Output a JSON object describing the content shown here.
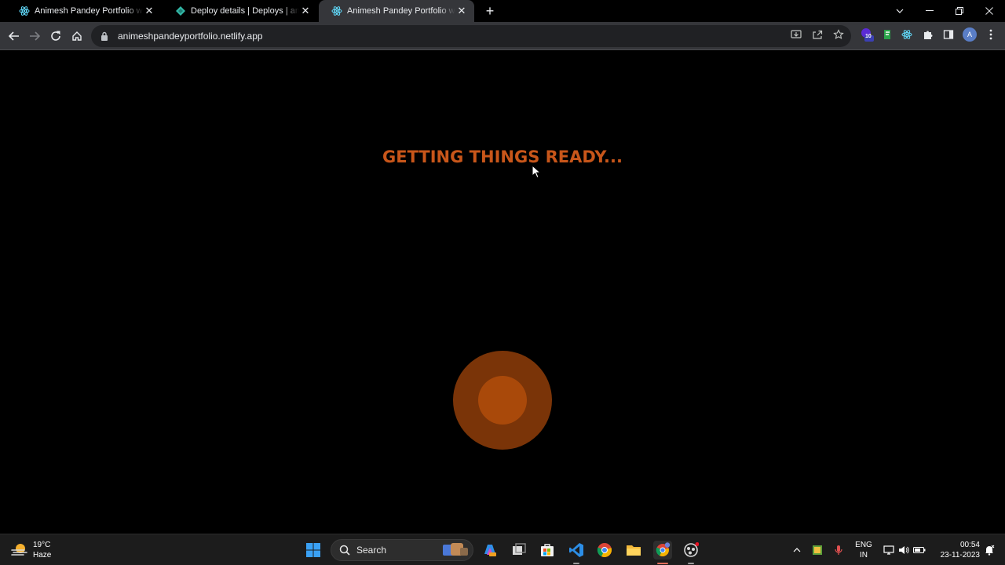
{
  "browser": {
    "tabs": [
      {
        "title": "Animesh Pandey Portfolio website",
        "favicon": "react-icon",
        "active": false
      },
      {
        "title": "Deploy details | Deploys | animesh",
        "favicon": "netlify-icon",
        "active": false
      },
      {
        "title": "Animesh Pandey Portfolio website",
        "favicon": "react-icon",
        "active": true
      }
    ],
    "url": "animeshpandeyportfolio.netlify.app",
    "extension_badge": "10",
    "profile_initial": "A"
  },
  "page": {
    "loading_text": "GETTING THINGS READY...",
    "accent_color": "#c8561a",
    "loader_outer_color": "#7a3408",
    "loader_inner_color": "#a9490a"
  },
  "taskbar": {
    "weather": {
      "temp": "19°C",
      "condition": "Haze"
    },
    "search_label": "Search",
    "language": {
      "line1": "ENG",
      "line2": "IN"
    },
    "clock": {
      "time": "00:54",
      "date": "23-11-2023"
    }
  }
}
